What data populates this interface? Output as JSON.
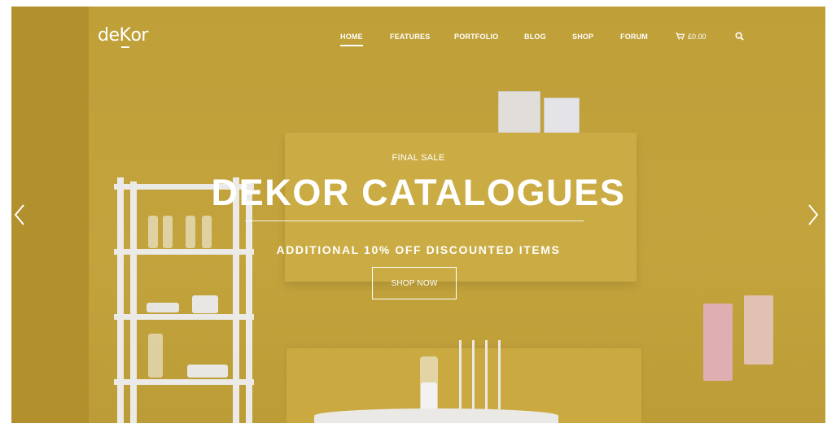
{
  "brand": {
    "logo_pre": "de",
    "logo_k": "K",
    "logo_post": "or"
  },
  "nav": {
    "items": [
      {
        "label": "HOME",
        "active": true
      },
      {
        "label": "FEATURES"
      },
      {
        "label": "PORTFOLIO"
      },
      {
        "label": "BLOG"
      },
      {
        "label": "SHOP"
      },
      {
        "label": "FORUM"
      }
    ],
    "cart_total": "£0.00",
    "cart_icon": "cart-icon",
    "search_icon": "search-icon"
  },
  "slider": {
    "kicker": "FINAL SALE",
    "headline": "DEKOR CATALOGUES",
    "subline": "ADDITIONAL 10% OFF DISCOUNTED ITEMS",
    "cta_label": "SHOP NOW",
    "prev_icon": "chevron-left-icon",
    "next_icon": "chevron-right-icon"
  },
  "colors": {
    "background": "#c9a83c",
    "text": "#ffffff"
  }
}
